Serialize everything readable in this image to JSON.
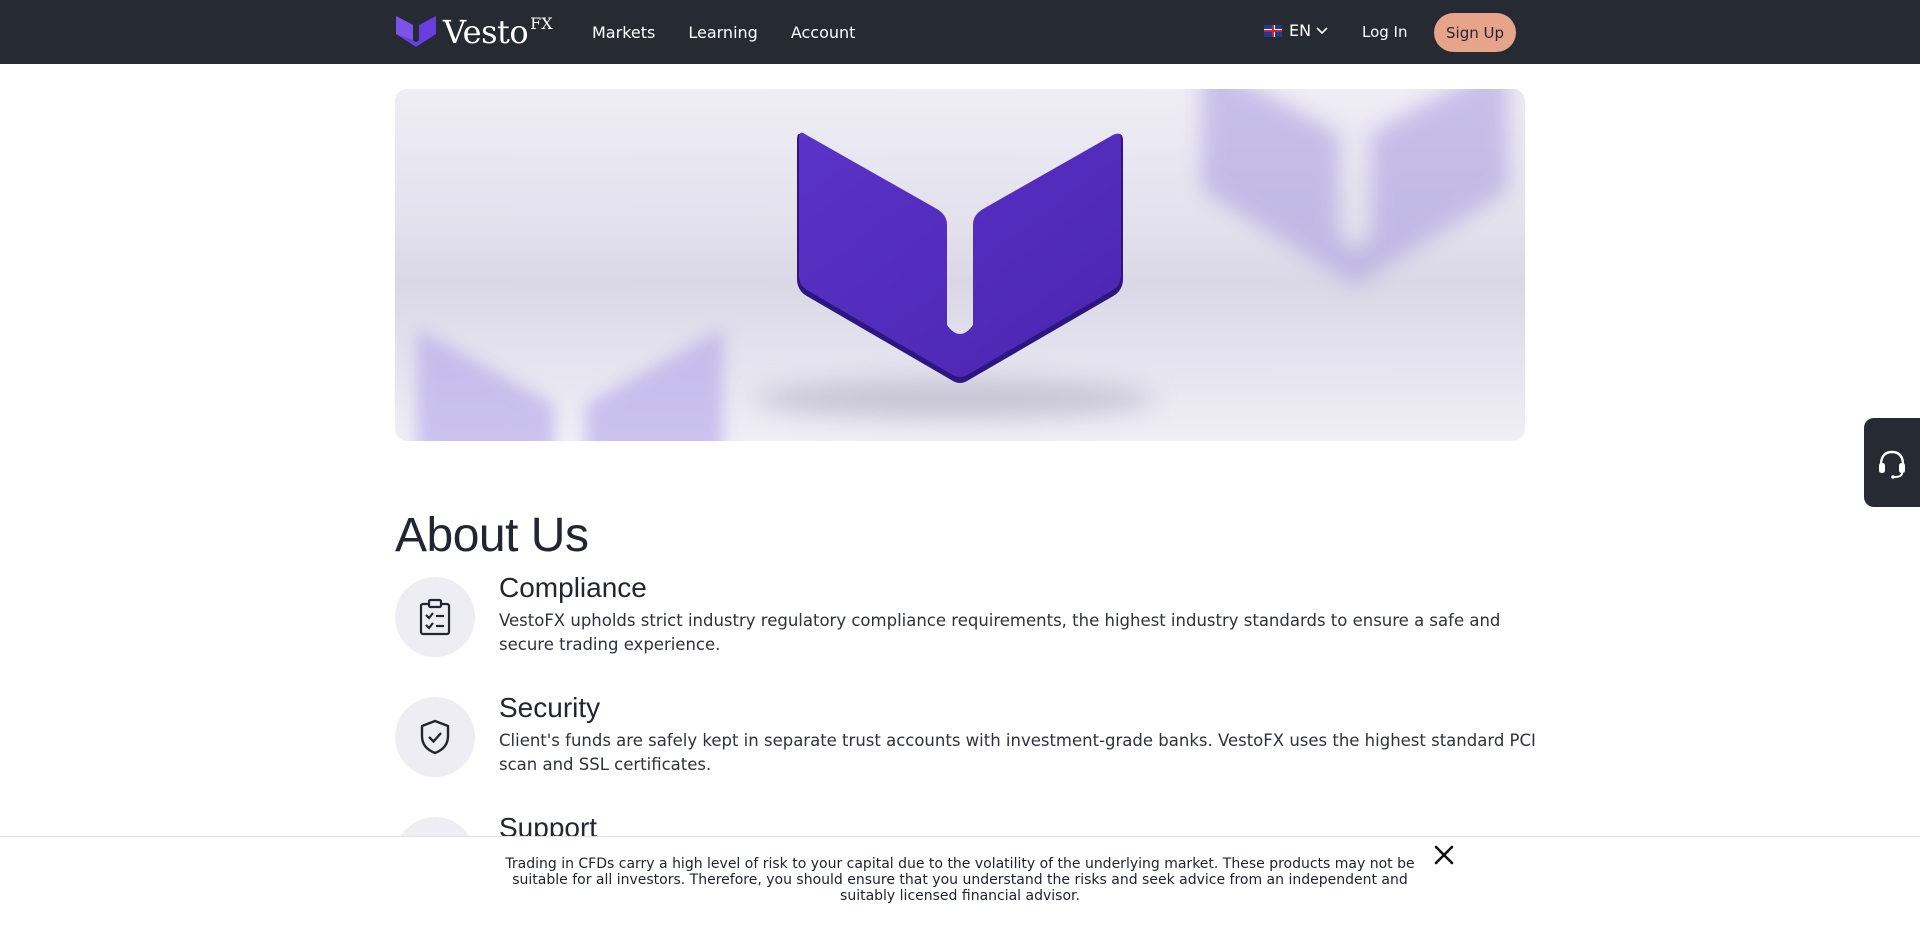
{
  "brand": {
    "name": "Vesto",
    "superscript": "FX",
    "accent_color": "#5b2fc9",
    "header_bg": "#262a33",
    "signup_color": "#e8a48a"
  },
  "nav": {
    "items": [
      {
        "label": "Markets",
        "icon": ""
      },
      {
        "label": "Learning",
        "icon": ""
      },
      {
        "label": "Account",
        "icon": ""
      }
    ]
  },
  "header": {
    "language": "EN",
    "language_flag_icon": "uk-flag-icon",
    "login_label": "Log In",
    "signup_label": "Sign Up"
  },
  "about": {
    "title": "About Us",
    "features": [
      {
        "title": "Compliance",
        "text": "VestoFX upholds strict industry regulatory compliance requirements, the highest industry standards to ensure a safe and secure trading experience.",
        "icon": "clipboard-check-icon"
      },
      {
        "title": "Security",
        "text": "Client's funds are safely kept in separate trust accounts with investment-grade banks. VestoFX uses the highest standard PCI scan and SSL certificates.",
        "icon": "shield-check-icon"
      },
      {
        "title": "Support",
        "text": "",
        "icon": "support-icon"
      }
    ]
  },
  "support_widget": {
    "icon": "headset-icon"
  },
  "risk_banner": {
    "text": "Trading in CFDs carry a high level of risk to your capital due to the volatility of the underlying market. These products may not be suitable for all investors. Therefore, you should ensure that you understand the risks and seek advice from an independent and suitably licensed financial advisor.",
    "close_icon": "close-icon"
  }
}
